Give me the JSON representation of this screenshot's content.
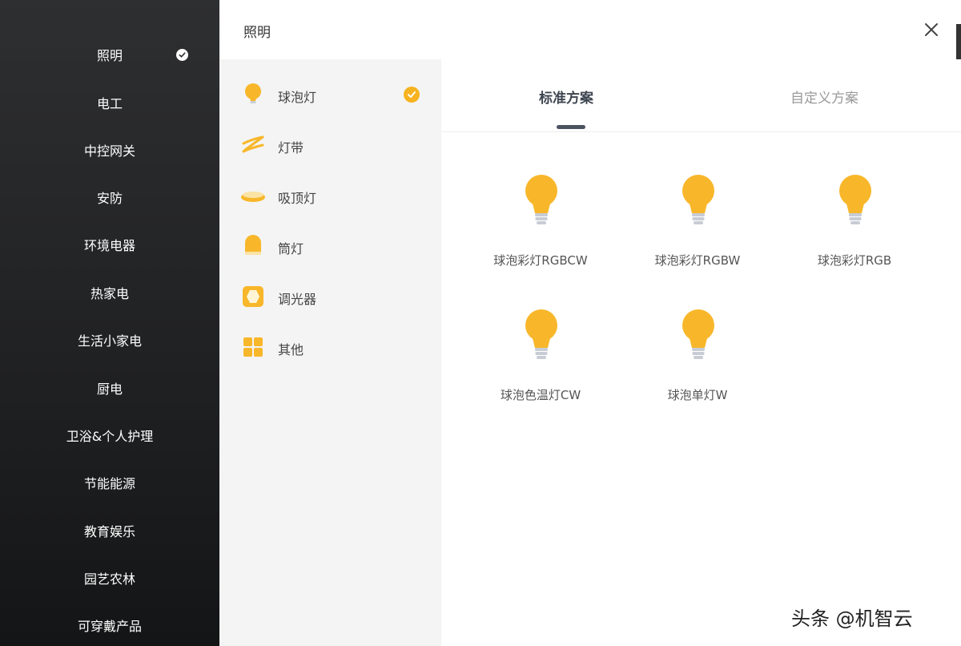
{
  "sidebar": {
    "categories": [
      {
        "label": "照明",
        "selected": true
      },
      {
        "label": "电工"
      },
      {
        "label": "中控网关"
      },
      {
        "label": "安防"
      },
      {
        "label": "环境电器"
      },
      {
        "label": "热家电"
      },
      {
        "label": "生活小家电"
      },
      {
        "label": "厨电"
      },
      {
        "label": "卫浴&个人护理"
      },
      {
        "label": "节能能源"
      },
      {
        "label": "教育娱乐"
      },
      {
        "label": "园艺农林"
      },
      {
        "label": "可穿戴产品"
      }
    ]
  },
  "dialog": {
    "title": "照明",
    "close_icon": "close-icon"
  },
  "subcategories": [
    {
      "label": "球泡灯",
      "icon": "bulb-icon",
      "selected": true
    },
    {
      "label": "灯带",
      "icon": "light-strip-icon"
    },
    {
      "label": "吸顶灯",
      "icon": "ceiling-light-icon"
    },
    {
      "label": "筒灯",
      "icon": "downlight-icon"
    },
    {
      "label": "调光器",
      "icon": "dimmer-icon"
    },
    {
      "label": "其他",
      "icon": "grid-icon"
    }
  ],
  "tabs": [
    {
      "label": "标准方案",
      "active": true
    },
    {
      "label": "自定义方案",
      "active": false
    }
  ],
  "products": [
    {
      "name": "球泡彩灯RGBCW",
      "icon": "bulb-icon"
    },
    {
      "name": "球泡彩灯RGBW",
      "icon": "bulb-icon"
    },
    {
      "name": "球泡彩灯RGB",
      "icon": "bulb-icon"
    },
    {
      "name": "球泡色温灯CW",
      "icon": "bulb-icon"
    },
    {
      "name": "球泡单灯W",
      "icon": "bulb-icon"
    }
  ],
  "watermark": "头条 @机智云",
  "colors": {
    "accent": "#f6b31f",
    "sidebar_bg": "#1f2022",
    "tab_active": "#3f4650"
  }
}
